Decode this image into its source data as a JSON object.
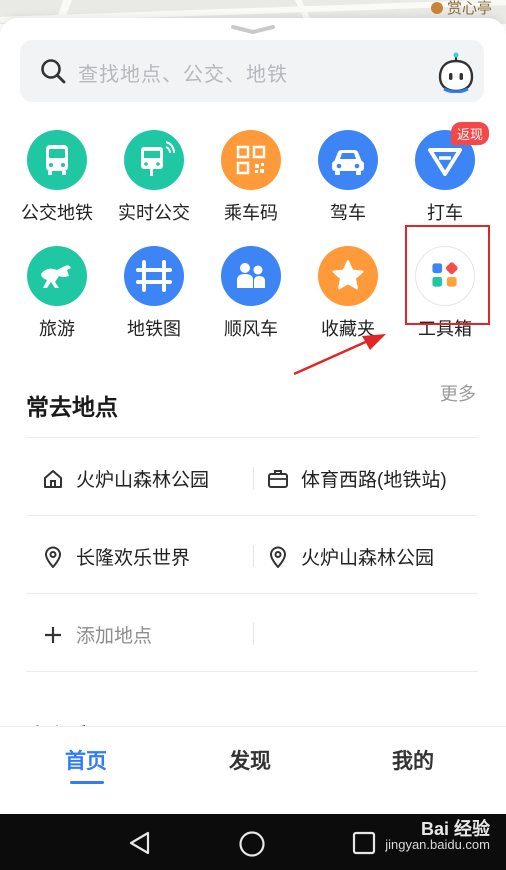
{
  "map": {
    "poi_label": "赏心亭"
  },
  "search": {
    "placeholder": "查找地点、公交、地铁"
  },
  "shortcuts": [
    {
      "label": "公交地铁",
      "icon": "bus-icon",
      "color": "#1fc8a3"
    },
    {
      "label": "实时公交",
      "icon": "realtime-bus-icon",
      "color": "#1fc8a3"
    },
    {
      "label": "乘车码",
      "icon": "qr-code-icon",
      "color": "#ff9a3a"
    },
    {
      "label": "驾车",
      "icon": "car-icon",
      "color": "#3d84f5"
    },
    {
      "label": "打车",
      "icon": "taxi-icon",
      "color": "#3d84f5",
      "badge": "返现"
    },
    {
      "label": "旅游",
      "icon": "horse-icon",
      "color": "#1fc8a3"
    },
    {
      "label": "地铁图",
      "icon": "metro-map-icon",
      "color": "#3d84f5"
    },
    {
      "label": "顺风车",
      "icon": "carpool-icon",
      "color": "#3d84f5"
    },
    {
      "label": "收藏夹",
      "icon": "star-icon",
      "color": "#ff9a3a"
    },
    {
      "label": "工具箱",
      "icon": "toolbox-icon",
      "color": "#ffffff"
    }
  ],
  "frequent": {
    "title": "常去地点",
    "more": "更多",
    "places": [
      {
        "label": "火炉山森林公园",
        "icon": "home-icon"
      },
      {
        "label": "体育西路(地铁站)",
        "icon": "briefcase-icon"
      },
      {
        "label": "长隆欢乐世界",
        "icon": "location-pin-icon"
      },
      {
        "label": "火炉山森林公园",
        "icon": "location-pin-icon"
      }
    ],
    "add_label": "添加地点"
  },
  "mini_programs": {
    "title": "小程序"
  },
  "tabs": [
    {
      "label": "首页",
      "active": true
    },
    {
      "label": "发现",
      "active": false
    },
    {
      "label": "我的",
      "active": false
    }
  ],
  "watermark": {
    "brand": "Bai 经验",
    "url": "jingyan.baidu.com"
  },
  "colors": {
    "accent": "#2f7cf6",
    "highlight": "#e02626"
  }
}
